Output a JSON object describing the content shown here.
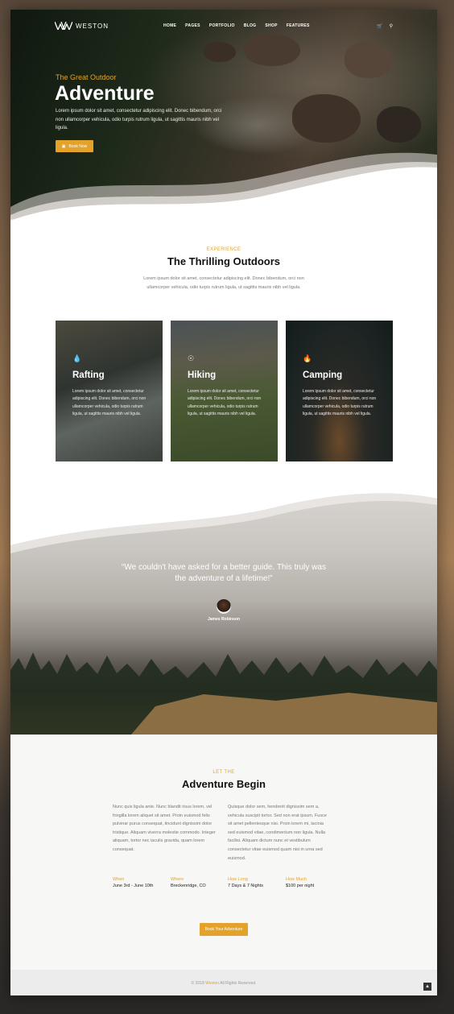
{
  "brand": {
    "name": "WESTON"
  },
  "nav": {
    "items": [
      "HOME",
      "PAGES",
      "PORTFOLIO",
      "BLOG",
      "SHOP",
      "FEATURES"
    ]
  },
  "hero": {
    "kicker": "The Great Outdoor",
    "title": "Adventure",
    "text": "Lorem ipsum dolor sit amet, consectetur adipiscing elit. Donec bibendum, orci non ullamcorper vehicula, odio turpis rutrum ligula, ut sagittis mauris nibh vel ligula.",
    "button": "Book Now"
  },
  "experience": {
    "kicker": "EXPERIENCE",
    "title": "The Thrilling Outdoors",
    "text": "Lorem ipsum dolor sit amet, consectetur adipiscing elit. Donec bibendum, orci non ullamcorper vehicula, odio turpis rutrum ligula, ut sagittis mauris nibh vel ligula."
  },
  "cards": [
    {
      "title": "Rafting",
      "icon": "water-drop-icon",
      "text": "Lorem ipsum dolor sit amet, consectetur adipiscing elit. Donec bibendum, orci non ullamcorper vehicula, odio turpis rutrum ligula, ut sagittis mauris nibh vel ligula."
    },
    {
      "title": "Hiking",
      "icon": "compass-icon",
      "text": "Lorem ipsum dolor sit amet, consectetur adipiscing elit. Donec bibendum, orci non ullamcorper vehicula, odio turpis rutrum ligula, ut sagittis mauris nibh vel ligula."
    },
    {
      "title": "Camping",
      "icon": "fire-icon",
      "text": "Lorem ipsum dolor sit amet, consectetur adipiscing elit. Donec bibendum, orci non ullamcorper vehicula, odio turpis rutrum ligula, ut sagittis mauris nibh vel ligula."
    }
  ],
  "testimonial": {
    "quote": "“We couldn't have asked for a better guide. This truly was the adventure of a lifetime!”",
    "name": "James Robinson"
  },
  "adventure": {
    "kicker": "LET THE",
    "title": "Adventure Begin",
    "col1": "Nunc quis ligula ante. Nunc blandit risus lorem, vel fringilla lorem aliquet sit amet. Proin euismod felis pulvinar purus consequat, tincidunt dignissim dolor tristique. Aliquam viverra molestie commodo. Integer aliquam, tortor nec iaculis gravida, quam lorem consequat.",
    "col2": "Quisque dolor sem, hendrerit dignissim sem a, vehicula suscipit tortor. Sed non erat ipsum. Fusce sit amet pellentesque nisi. Proin lorem mi, lacinia sed euismod vitae, condimentum non ligula. Nulla facilisi. Aliquam dictum nunc et vestibulum consectetur vitae euismod quam nisi in urna sed euismod.",
    "details": [
      {
        "label": "When",
        "value": "June 3rd - June 10th"
      },
      {
        "label": "Where",
        "value": "Breckenridge, CO"
      },
      {
        "label": "How Long",
        "value": "7 Days & 7 Nights"
      },
      {
        "label": "How Much",
        "value": "$100 per night"
      }
    ],
    "button": "Book Your Adventure"
  },
  "footer": {
    "prefix": "© 2018",
    "brand": "Weston",
    "suffix": "All Rights Reserved."
  },
  "colors": {
    "accent": "#e3a32b"
  }
}
